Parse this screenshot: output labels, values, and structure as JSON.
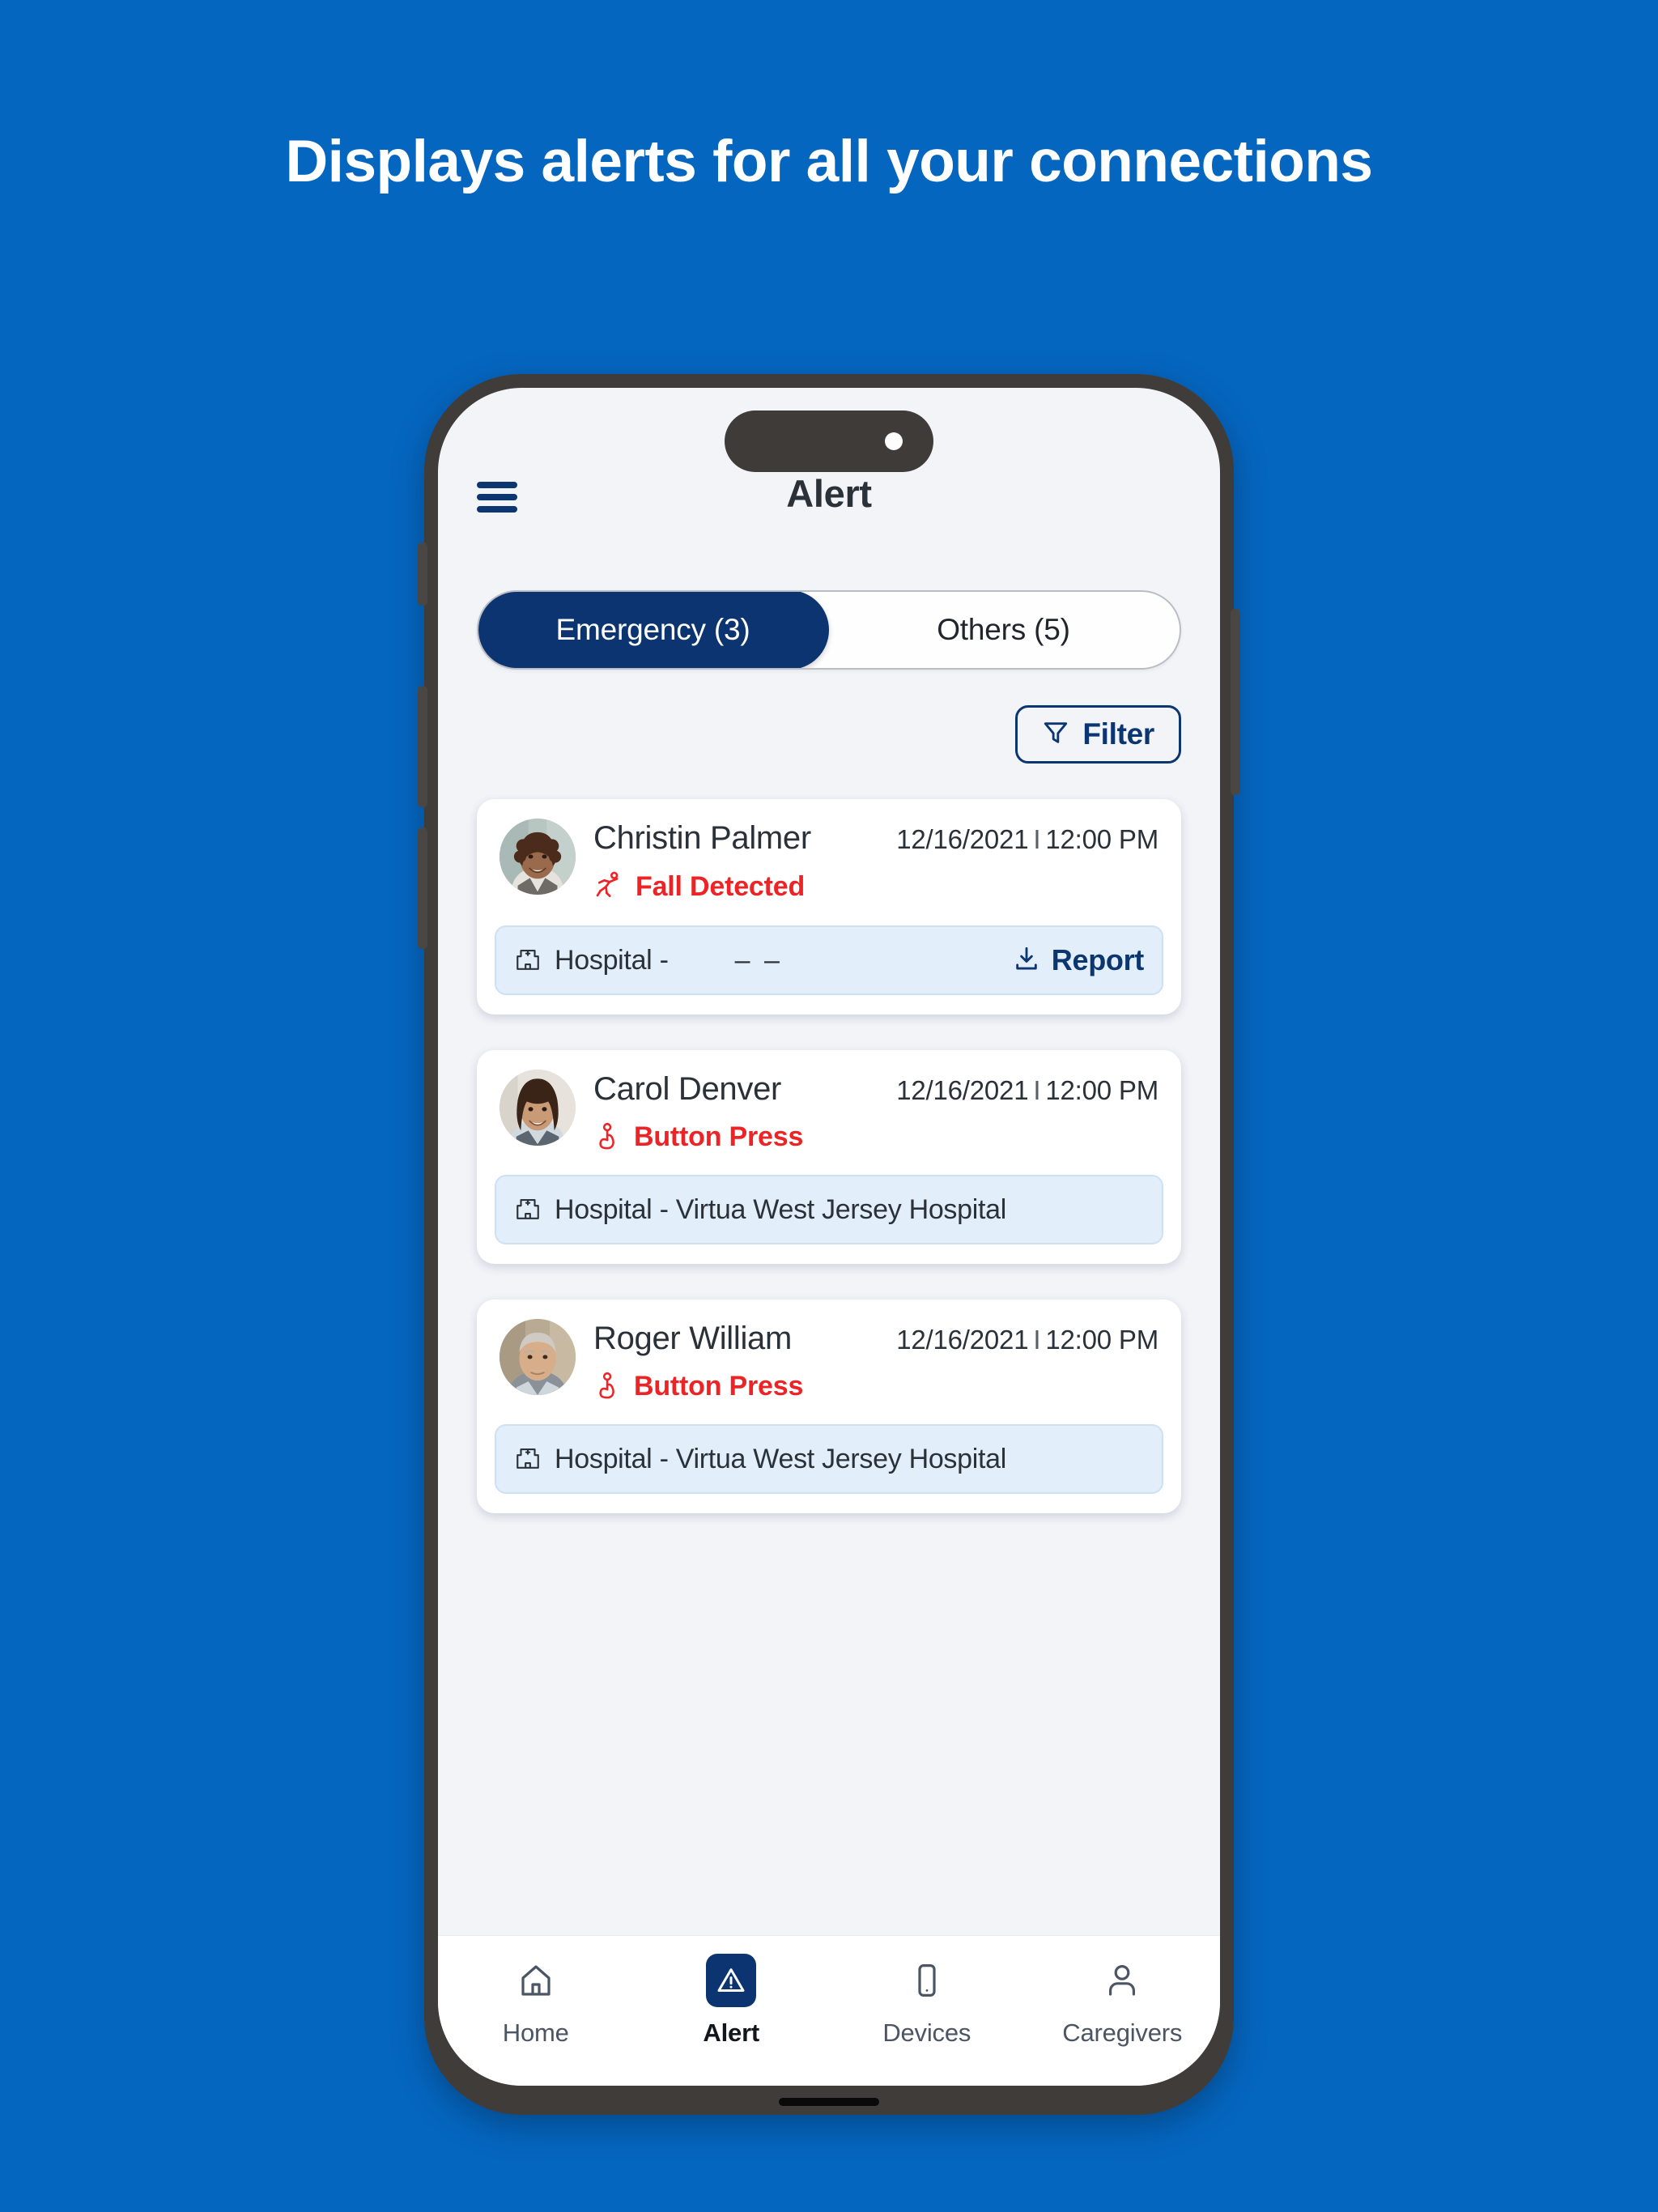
{
  "page": {
    "background_color": "#0566c0",
    "headline": "Displays alerts for all your connections"
  },
  "phone": {
    "app_bar": {
      "menu_icon": "hamburger-menu-icon",
      "title": "Alert"
    },
    "tabs": [
      {
        "label": "Emergency (3)",
        "active": true
      },
      {
        "label": "Others (5)",
        "active": false
      }
    ],
    "filter": {
      "icon": "funnel-filter-icon",
      "label": "Filter"
    },
    "alerts": [
      {
        "avatar": "woman-curly-hair-avatar",
        "name": "Christin Palmer",
        "date": "12/16/2021",
        "separator": "I",
        "time": "12:00 PM",
        "reason_icon": "fall-detected-icon",
        "reason": "Fall Detected",
        "hospital_icon": "hospital-building-icon",
        "hospital": "Hospital -",
        "hospital_value": "– –",
        "report": {
          "icon": "download-icon",
          "label": "Report"
        }
      },
      {
        "avatar": "woman-long-hair-avatar",
        "name": "Carol Denver",
        "date": "12/16/2021",
        "separator": "I",
        "time": "12:00 PM",
        "reason_icon": "button-press-icon",
        "reason": "Button Press",
        "hospital_icon": "hospital-building-icon",
        "hospital": "Hospital - Virtua West Jersey Hospital",
        "hospital_value": "",
        "report": null
      },
      {
        "avatar": "older-man-avatar",
        "name": "Roger William",
        "date": "12/16/2021",
        "separator": "I",
        "time": "12:00 PM",
        "reason_icon": "button-press-icon",
        "reason": "Button Press",
        "hospital_icon": "hospital-building-icon",
        "hospital": "Hospital - Virtua West Jersey Hospital",
        "hospital_value": "",
        "report": null
      }
    ],
    "bottom_nav": [
      {
        "label": "Home",
        "icon": "home-icon",
        "active": false
      },
      {
        "label": "Alert",
        "icon": "alert-triangle-icon",
        "active": true
      },
      {
        "label": "Devices",
        "icon": "device-phone-icon",
        "active": false
      },
      {
        "label": "Caregivers",
        "icon": "person-icon",
        "active": false
      }
    ]
  },
  "colors": {
    "brand_blue": "#0566c0",
    "navy": "#0b3470",
    "alert_red": "#ee2326",
    "screen_bg": "#f2f4f8",
    "hospital_bar": "#e2eefa"
  }
}
